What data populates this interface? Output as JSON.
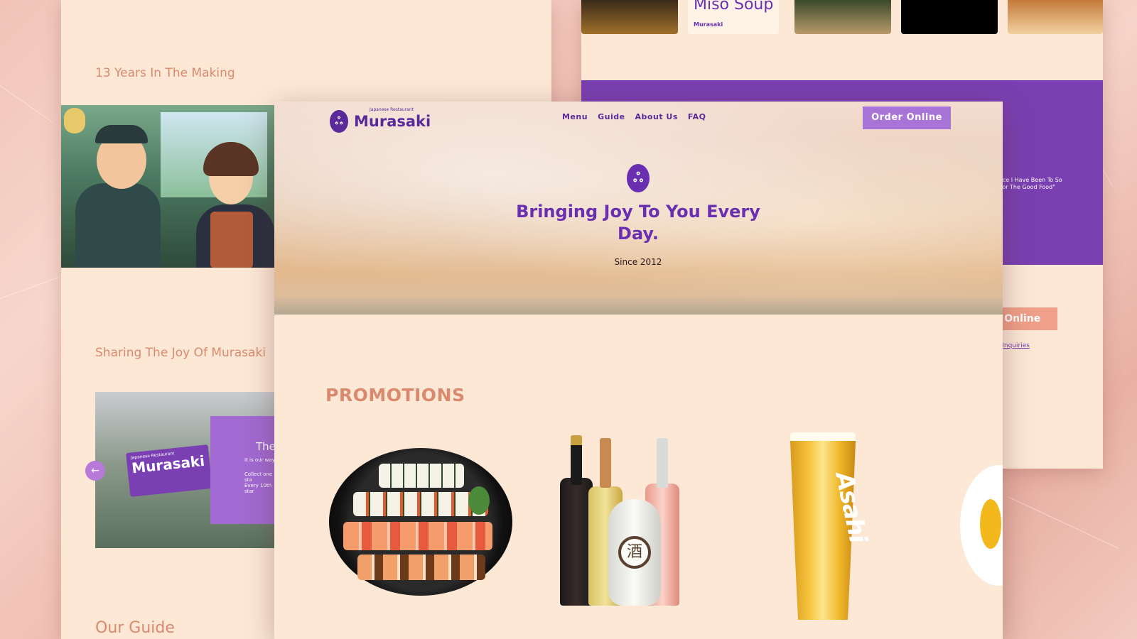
{
  "left_page": {
    "heading_years": "13 Years In The Making",
    "heading_sharing": "Sharing The Joy Of Murasaki",
    "heading_guide": "Our Guide",
    "sign_subtitle": "Japanese Restaurant",
    "sign_name": "Murasaki",
    "promo_card_title": "The",
    "promo_card_line1": "It is our way",
    "promo_card_line2": "Collect one sta",
    "promo_card_line3": "Every 10th star"
  },
  "right_page": {
    "thumb_title": "Miso Soup",
    "thumb_brand": "Murasaki",
    "testimonial_line1": "ace I Have Been To So",
    "testimonial_line2": "For The Good Food\"",
    "order_button": "er Online",
    "inquiries_link": "ur Inquiries"
  },
  "header": {
    "logo_subtitle": "Japanese Restaurant",
    "logo_name": "Murasaki",
    "nav": [
      "Menu",
      "Guide",
      "About Us",
      "FAQ"
    ],
    "order_button": "Order Online"
  },
  "hero": {
    "tagline": "Bringing Joy To You Every Day.",
    "since": "Since 2012"
  },
  "promotions": {
    "heading": "PROMOTIONS",
    "sake_glyph": "酒",
    "beer_brand": "Asahi"
  },
  "colors": {
    "brand_purple": "#6a2fb0",
    "button_purple": "#a874d8",
    "heading_salmon": "#d98a6e",
    "page_cream": "#fde8d6"
  },
  "icons": {
    "logo": "murasaki-logo-icon",
    "carousel_prev": "arrow-left-icon"
  }
}
